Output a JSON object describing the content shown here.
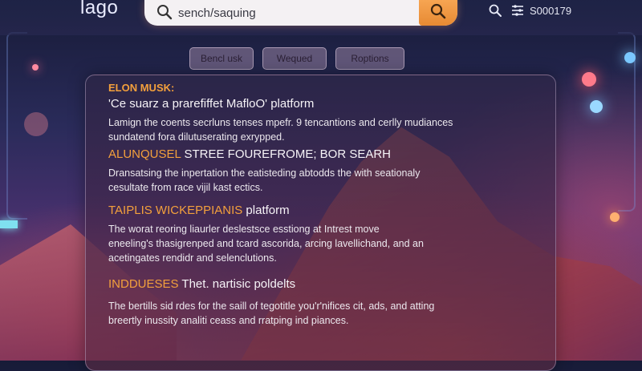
{
  "header": {
    "logo": "lago",
    "search": {
      "value": "sench/saquing",
      "placeholder": ""
    },
    "count": "S000179"
  },
  "filters": [
    "Bencl usk",
    "Wequed",
    "Roptions"
  ],
  "results": [
    {
      "tag": "ELON MUSK:",
      "title": "'Ce suarz a prarefiffet MafloO' platform",
      "desc_lines": [
        "Lamign the coents secrluns tenses mpefr. 9 tencantions and cerlly mudiances",
        "sundatend fora dilutuserating exrypped."
      ]
    },
    {
      "highlight": "ALUNQUSEL",
      "rest": " STREE FOUREFROME; BOR SEARH",
      "desc_lines": [
        "Dransatsing the inpertation the eatisteding abtodds the with seationaly",
        "cesultate from race vijil kast ectics."
      ]
    },
    {
      "highlight": "TAIPLIS WICKEPPIANIS",
      "rest": " platform",
      "desc_lines": [
        "The worat reoring liaurler deslestsce esstiong at Intrest move",
        "eneeling's thasigrenped and tcard ascorida, arcing lavellichand, and an",
        "acetingates rendidr and selenclutions."
      ]
    },
    {
      "highlight": "INDDUESES",
      "rest": " Thet. nartisic poldelts",
      "desc_lines": [
        "The bertills sid rdes for the saill of tegotitle you'r'nifices cit, ads, and atting",
        "breertly inussity analiti ceass and rratping ind piances."
      ]
    }
  ],
  "colors": {
    "accent": "#f3a03c",
    "search_button": "#e78a33"
  },
  "icons": [
    "search-icon",
    "filter-icon"
  ]
}
